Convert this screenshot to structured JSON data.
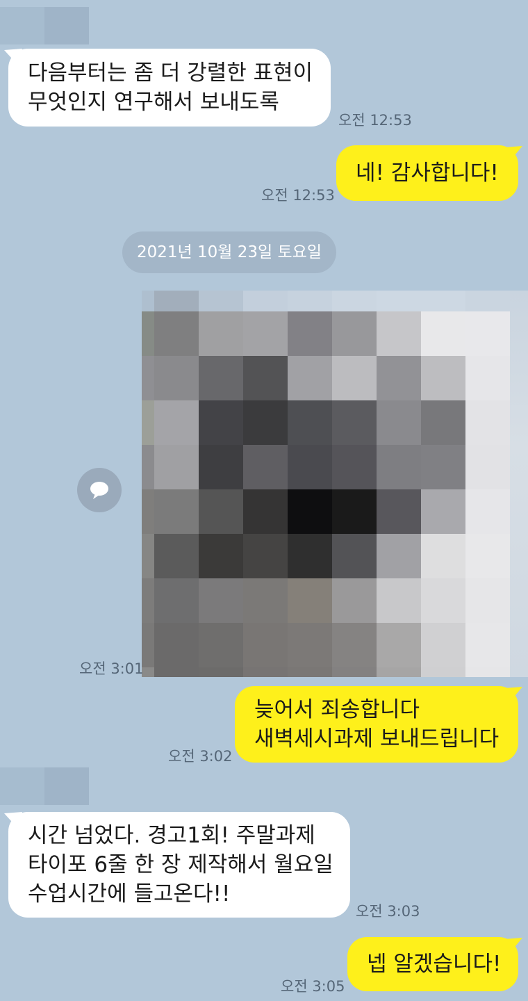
{
  "messages": [
    {
      "id": "m1",
      "direction": "in",
      "lines": [
        "다음부터는 좀 더 강렬한 표현이",
        "무엇인지 연구해서 보내도록"
      ],
      "time": "오전 12:53"
    },
    {
      "id": "m2",
      "direction": "out",
      "lines": [
        "네! 감사합니다!"
      ],
      "time": "오전 12:53"
    },
    {
      "id": "d1",
      "type": "date",
      "text": "2021년 10월 23일 토요일"
    },
    {
      "id": "m3",
      "direction": "out",
      "type": "image",
      "time": "오전 3:01"
    },
    {
      "id": "m4",
      "direction": "out",
      "lines": [
        "늦어서 죄송합니다",
        "새벽세시과제 보내드립니다"
      ],
      "time": "오전 3:02"
    },
    {
      "id": "m5",
      "direction": "in",
      "lines": [
        "시간 넘었다. 경고1회! 주말과제",
        "타이포 6줄 한 장 제작해서 월요일",
        "수업시간에 들고온다!!"
      ],
      "time": "오전 3:03"
    },
    {
      "id": "m6",
      "direction": "out",
      "lines": [
        "넵 알겠습니다!"
      ],
      "time": "오전 3:05"
    }
  ],
  "icons": {
    "share": "speech-bubble-icon"
  },
  "colors": {
    "background": "#b2c7d9",
    "incoming": "#ffffff",
    "outgoing": "#fef01b"
  }
}
